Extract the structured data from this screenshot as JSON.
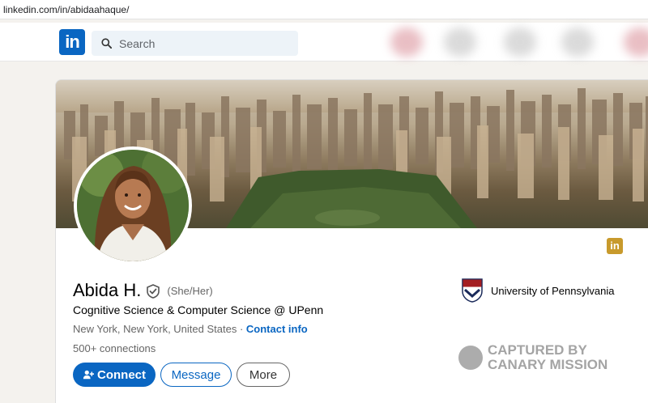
{
  "browser": {
    "url": "linkedin.com/in/abidaahaque/"
  },
  "nav": {
    "logo_text": "in",
    "search_placeholder": "Search"
  },
  "profile": {
    "name": "Abida H.",
    "pronouns": "(She/Her)",
    "headline": "Cognitive Science & Computer Science @ UPenn",
    "location": "New York, New York, United States",
    "location_separator": " · ",
    "contact_info": "Contact info",
    "connections": "500+ connections",
    "education": "University of Pennsylvania",
    "small_badge": "in"
  },
  "actions": {
    "connect": "Connect",
    "message": "Message",
    "more": "More"
  },
  "watermark": {
    "line1": "CAPTURED BY",
    "line2": "CANARY MISSION"
  },
  "colors": {
    "brand": "#0a66c2",
    "page_bg": "#f4f2ee",
    "badge_gold": "#c89a2c"
  },
  "icons": [
    "search-icon",
    "verified-shield-icon",
    "connect-user-plus-icon",
    "university-shield-icon",
    "canary-mission-logo-icon"
  ]
}
